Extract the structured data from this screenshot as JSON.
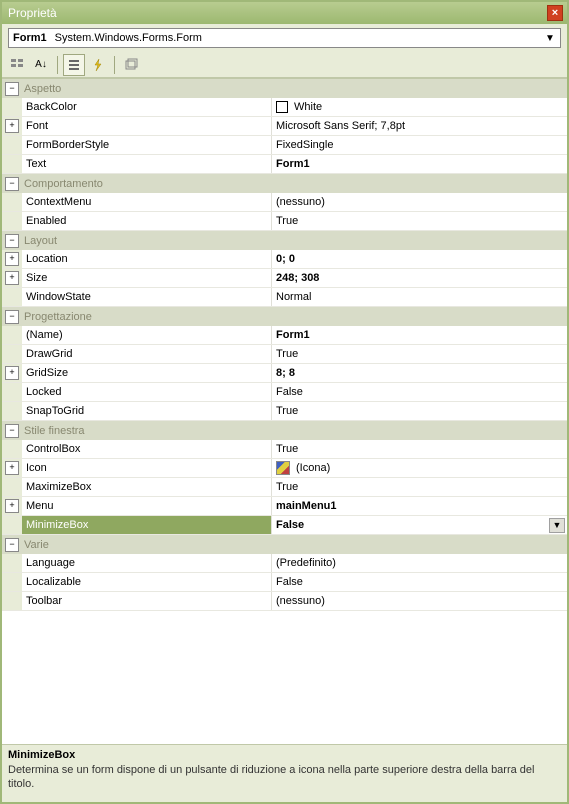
{
  "window": {
    "title": "Proprietà"
  },
  "selector": {
    "object_name": "Form1",
    "object_type": "System.Windows.Forms.Form"
  },
  "toolbar": {
    "categorized": "Categorized",
    "alphabetical": "Alphabetical",
    "properties": "Properties",
    "events": "Events",
    "pages": "Property Pages"
  },
  "categories": [
    {
      "name": "Aspetto",
      "props": [
        {
          "name": "BackColor",
          "value": "White",
          "bold": false,
          "expand": null,
          "swatch": "color"
        },
        {
          "name": "Font",
          "value": "Microsoft Sans Serif; 7,8pt",
          "bold": false,
          "expand": "+"
        },
        {
          "name": "FormBorderStyle",
          "value": "FixedSingle",
          "bold": false,
          "expand": null
        },
        {
          "name": "Text",
          "value": "Form1",
          "bold": true,
          "expand": null
        }
      ]
    },
    {
      "name": "Comportamento",
      "props": [
        {
          "name": "ContextMenu",
          "value": "(nessuno)",
          "bold": false,
          "expand": null
        },
        {
          "name": "Enabled",
          "value": "True",
          "bold": false,
          "expand": null
        }
      ]
    },
    {
      "name": "Layout",
      "props": [
        {
          "name": "Location",
          "value": "0; 0",
          "bold": true,
          "expand": "+"
        },
        {
          "name": "Size",
          "value": "248; 308",
          "bold": true,
          "expand": "+"
        },
        {
          "name": "WindowState",
          "value": "Normal",
          "bold": false,
          "expand": null
        }
      ]
    },
    {
      "name": "Progettazione",
      "props": [
        {
          "name": "(Name)",
          "value": "Form1",
          "bold": true,
          "expand": null
        },
        {
          "name": "DrawGrid",
          "value": "True",
          "bold": false,
          "expand": null
        },
        {
          "name": "GridSize",
          "value": "8; 8",
          "bold": true,
          "expand": "+"
        },
        {
          "name": "Locked",
          "value": "False",
          "bold": false,
          "expand": null
        },
        {
          "name": "SnapToGrid",
          "value": "True",
          "bold": false,
          "expand": null
        }
      ]
    },
    {
      "name": "Stile finestra",
      "props": [
        {
          "name": "ControlBox",
          "value": "True",
          "bold": false,
          "expand": null
        },
        {
          "name": "Icon",
          "value": "(Icona)",
          "bold": false,
          "expand": "+",
          "swatch": "icon"
        },
        {
          "name": "MaximizeBox",
          "value": "True",
          "bold": false,
          "expand": null
        },
        {
          "name": "Menu",
          "value": "mainMenu1",
          "bold": true,
          "expand": "+"
        },
        {
          "name": "MinimizeBox",
          "value": "False",
          "bold": true,
          "expand": null,
          "selected": true,
          "dropdown": true
        }
      ]
    },
    {
      "name": "Varie",
      "props": [
        {
          "name": "Language",
          "value": "(Predefinito)",
          "bold": false,
          "expand": null
        },
        {
          "name": "Localizable",
          "value": "False",
          "bold": false,
          "expand": null
        },
        {
          "name": "Toolbar",
          "value": "(nessuno)",
          "bold": false,
          "expand": null
        }
      ]
    }
  ],
  "description": {
    "title": "MinimizeBox",
    "text": "Determina se un form dispone di un pulsante di riduzione a icona  nella parte superiore destra della barra del titolo."
  },
  "glyphs": {
    "minus": "⊟",
    "plus": "⊞",
    "close": "×",
    "down": "▼"
  }
}
